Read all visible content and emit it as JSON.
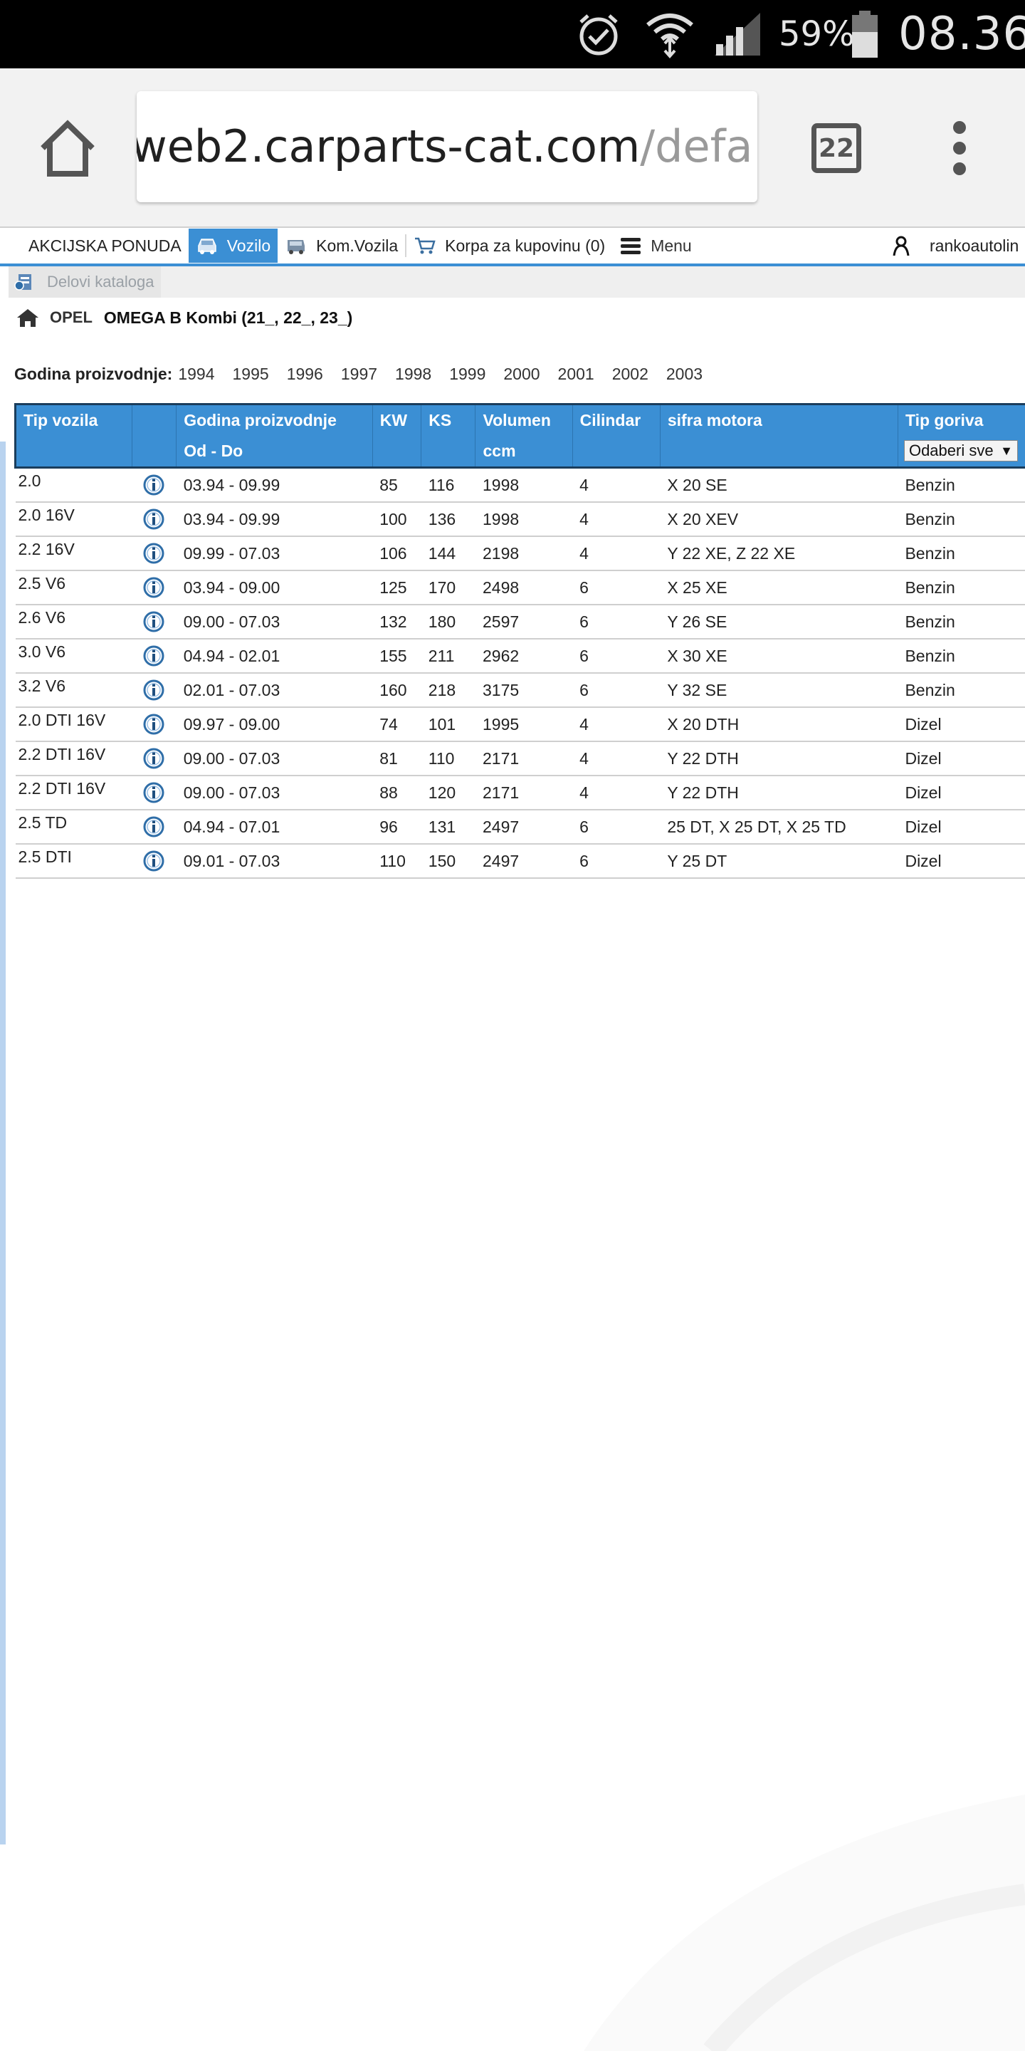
{
  "status_bar": {
    "battery_percent": "59%",
    "time": "08.36",
    "icons": [
      "alarm-icon",
      "wifi-icon",
      "signal-icon",
      "battery-icon"
    ]
  },
  "browser": {
    "url_host": "web2.carparts-cat.com",
    "url_path": "/defa",
    "tab_count": "22",
    "icons": [
      "home-icon",
      "tabs-icon",
      "overflow-menu-icon"
    ]
  },
  "nav": {
    "akcijska": "AKCIJSKA PONUDA",
    "vozilo": "Vozilo",
    "kom_vozila": "Kom.Vozila",
    "korpa": "Korpa za kupovinu (0)",
    "menu": "Menu",
    "user": "rankoautolin"
  },
  "breadcrumb": {
    "label": "Delovi kataloga"
  },
  "vehicle": {
    "make": "OPEL",
    "model": "OMEGA B Kombi (21_, 22_, 23_)"
  },
  "years": {
    "label": "Godina proizvodnje:",
    "list": [
      "1994",
      "1995",
      "1996",
      "1997",
      "1998",
      "1999",
      "2000",
      "2001",
      "2002",
      "2003"
    ]
  },
  "table": {
    "headers": {
      "tip_vozila": "Tip vozila",
      "godina": "Godina proizvodnje",
      "od_do": "Od - Do",
      "kw": "KW",
      "ks": "KS",
      "volumen": "Volumen",
      "ccm": "ccm",
      "cilindar": "Cilindar",
      "sifra": "sifra motora",
      "gorivo": "Tip goriva",
      "gorivo_select": "Odaberi sve"
    },
    "rows": [
      {
        "type": "2.0",
        "years": "03.94 - 09.99",
        "kw": "85",
        "ks": "116",
        "ccm": "1998",
        "cyl": "4",
        "engine": "X 20 SE",
        "fuel": "Benzin"
      },
      {
        "type": "2.0 16V",
        "years": "03.94 - 09.99",
        "kw": "100",
        "ks": "136",
        "ccm": "1998",
        "cyl": "4",
        "engine": "X 20 XEV",
        "fuel": "Benzin"
      },
      {
        "type": "2.2 16V",
        "years": "09.99 - 07.03",
        "kw": "106",
        "ks": "144",
        "ccm": "2198",
        "cyl": "4",
        "engine": "Y 22 XE, Z 22 XE",
        "fuel": "Benzin"
      },
      {
        "type": "2.5 V6",
        "years": "03.94 - 09.00",
        "kw": "125",
        "ks": "170",
        "ccm": "2498",
        "cyl": "6",
        "engine": "X 25 XE",
        "fuel": "Benzin"
      },
      {
        "type": "2.6 V6",
        "years": "09.00 - 07.03",
        "kw": "132",
        "ks": "180",
        "ccm": "2597",
        "cyl": "6",
        "engine": "Y 26 SE",
        "fuel": "Benzin"
      },
      {
        "type": "3.0 V6",
        "years": "04.94 - 02.01",
        "kw": "155",
        "ks": "211",
        "ccm": "2962",
        "cyl": "6",
        "engine": "X 30 XE",
        "fuel": "Benzin"
      },
      {
        "type": "3.2 V6",
        "years": "02.01 - 07.03",
        "kw": "160",
        "ks": "218",
        "ccm": "3175",
        "cyl": "6",
        "engine": "Y 32 SE",
        "fuel": "Benzin"
      },
      {
        "type": "2.0 DTI 16V",
        "years": "09.97 - 09.00",
        "kw": "74",
        "ks": "101",
        "ccm": "1995",
        "cyl": "4",
        "engine": "X 20 DTH",
        "fuel": "Dizel"
      },
      {
        "type": "2.2 DTI 16V",
        "years": "09.00 - 07.03",
        "kw": "81",
        "ks": "110",
        "ccm": "2171",
        "cyl": "4",
        "engine": "Y 22 DTH",
        "fuel": "Dizel"
      },
      {
        "type": "2.2 DTI 16V",
        "years": "09.00 - 07.03",
        "kw": "88",
        "ks": "120",
        "ccm": "2171",
        "cyl": "4",
        "engine": "Y 22 DTH",
        "fuel": "Dizel"
      },
      {
        "type": "2.5 TD",
        "years": "04.94 - 07.01",
        "kw": "96",
        "ks": "131",
        "ccm": "2497",
        "cyl": "6",
        "engine": "25 DT, X 25 DT, X 25 TD",
        "fuel": "Dizel"
      },
      {
        "type": "2.5 DTI",
        "years": "09.01 - 07.03",
        "kw": "110",
        "ks": "150",
        "ccm": "2497",
        "cyl": "6",
        "engine": "Y 25 DT",
        "fuel": "Dizel"
      }
    ]
  },
  "colors": {
    "accent": "#3b8fd4",
    "header_border": "#1a3d5c",
    "status_bar": "#000000"
  }
}
